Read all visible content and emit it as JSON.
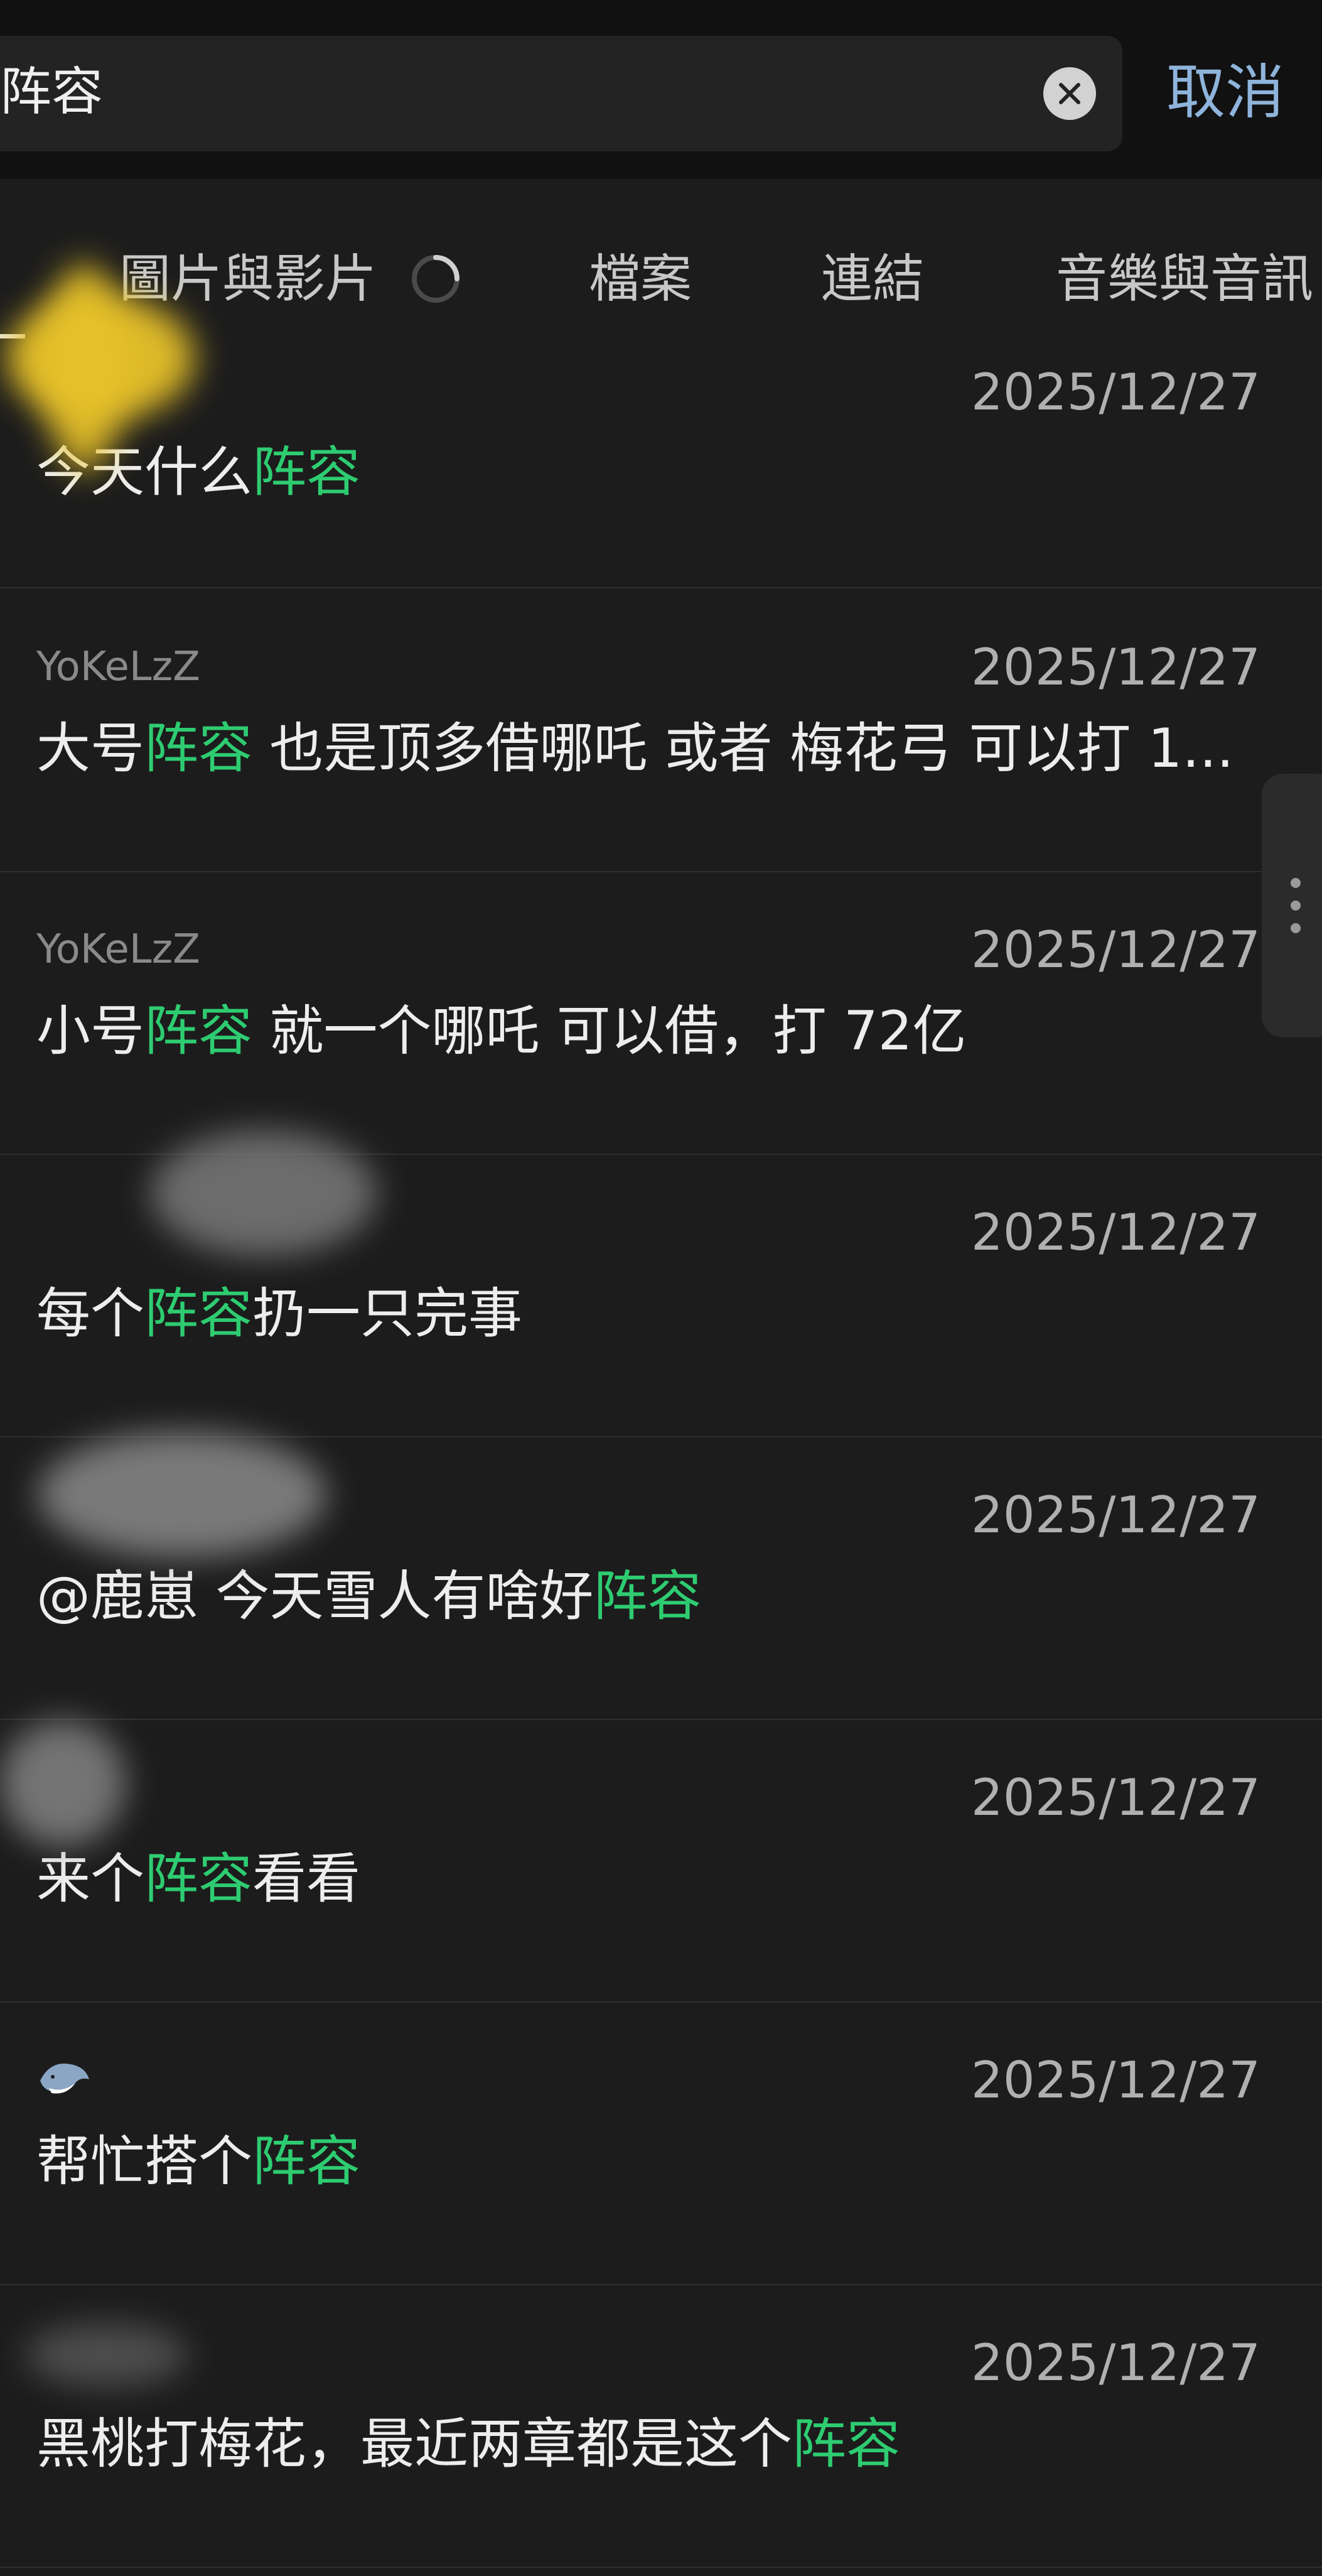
{
  "search": {
    "query": "阵容",
    "cancel_label": "取消"
  },
  "tabs": [
    {
      "label": "圖片與影片"
    },
    {
      "label": "檔案"
    },
    {
      "label": "連結"
    },
    {
      "label": "音樂與音訊"
    }
  ],
  "colors": {
    "highlight": "#2ecc71",
    "cancel": "#8fb4db",
    "background": "#1c1c1c"
  },
  "results": [
    {
      "sender": "",
      "date": "2025/12/27",
      "before": "今天什么",
      "match": "阵容",
      "after": ""
    },
    {
      "sender": "YoKeLzZ",
      "date": "2025/12/27",
      "before": "大号",
      "match": "阵容",
      "after": " 也是顶多借哪吒 或者 梅花弓 可以打 1..."
    },
    {
      "sender": "YoKeLzZ",
      "date": "2025/12/27",
      "before": "小号",
      "match": "阵容",
      "after": "  就一个哪吒 可以借，打 72亿"
    },
    {
      "sender": "",
      "date": "2025/12/27",
      "before": "每个",
      "match": "阵容",
      "after": "扔一只完事"
    },
    {
      "sender": "",
      "date": "2025/12/27",
      "before": "@鹿崽 今天雪人有啥好",
      "match": "阵容",
      "after": ""
    },
    {
      "sender": "",
      "date": "2025/12/27",
      "before": "来个",
      "match": "阵容",
      "after": "看看"
    },
    {
      "sender": "",
      "date": "2025/12/27",
      "before": "帮忙搭个",
      "match": "阵容",
      "after": ""
    },
    {
      "sender": "",
      "date": "2025/12/27",
      "before": "黑桃打梅花，最近两章都是这个",
      "match": "阵容",
      "after": ""
    }
  ]
}
